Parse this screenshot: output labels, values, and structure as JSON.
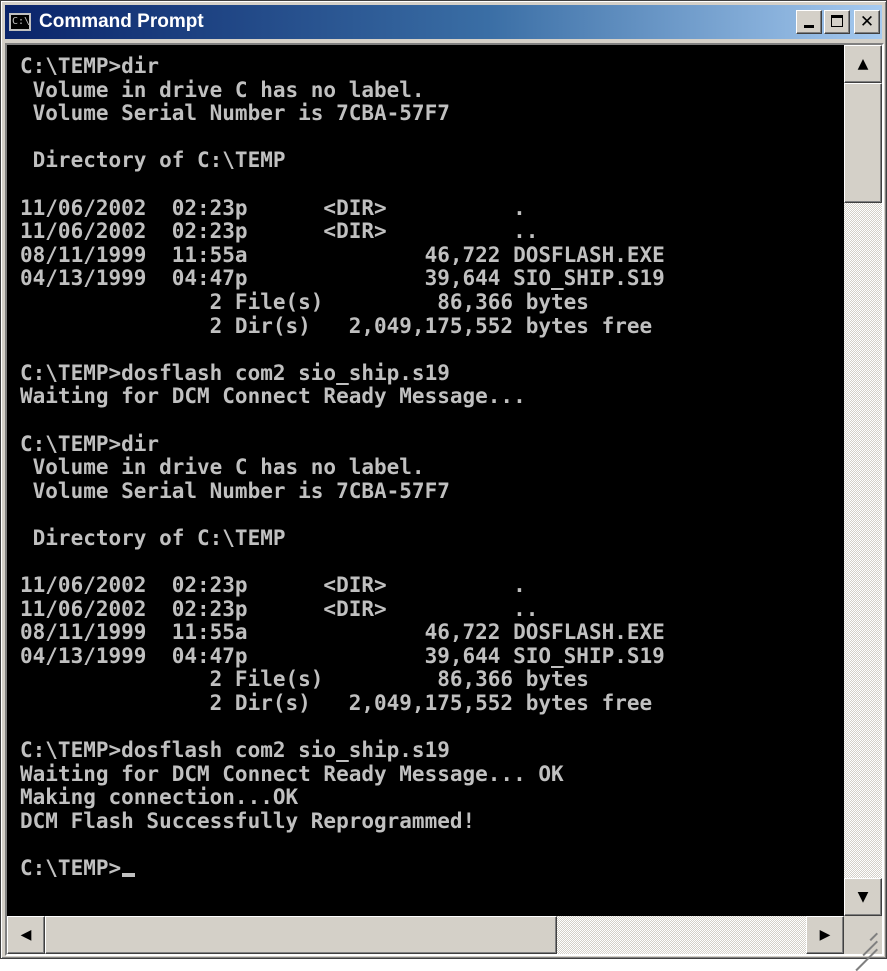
{
  "window": {
    "title": "Command Prompt",
    "icon": "command-prompt-icon",
    "icon_glyph": "C:\\",
    "buttons": {
      "minimize_icon": "minimize-icon",
      "maximize_icon": "maximize-icon",
      "close_icon": "close-icon",
      "close_glyph": "✕"
    }
  },
  "console": {
    "lines": [
      "C:\\TEMP>dir",
      " Volume in drive C has no label.",
      " Volume Serial Number is 7CBA-57F7",
      "",
      " Directory of C:\\TEMP",
      "",
      "11/06/2002  02:23p      <DIR>          .",
      "11/06/2002  02:23p      <DIR>          ..",
      "08/11/1999  11:55a              46,722 DOSFLASH.EXE",
      "04/13/1999  04:47p              39,644 SIO_SHIP.S19",
      "               2 File(s)         86,366 bytes",
      "               2 Dir(s)   2,049,175,552 bytes free",
      "",
      "C:\\TEMP>dosflash com2 sio_ship.s19",
      "Waiting for DCM Connect Ready Message...",
      "",
      "C:\\TEMP>dir",
      " Volume in drive C has no label.",
      " Volume Serial Number is 7CBA-57F7",
      "",
      " Directory of C:\\TEMP",
      "",
      "11/06/2002  02:23p      <DIR>          .",
      "11/06/2002  02:23p      <DIR>          ..",
      "08/11/1999  11:55a              46,722 DOSFLASH.EXE",
      "04/13/1999  04:47p              39,644 SIO_SHIP.S19",
      "               2 File(s)         86,366 bytes",
      "               2 Dir(s)   2,049,175,552 bytes free",
      "",
      "C:\\TEMP>dosflash com2 sio_ship.s19",
      "Waiting for DCM Connect Ready Message... OK",
      "Making connection...OK",
      "DCM Flash Successfully Reprogrammed!",
      "",
      "C:\\TEMP>"
    ]
  },
  "scrollbars": {
    "up_arrow": "▲",
    "down_arrow": "▼",
    "left_arrow": "◀",
    "right_arrow": "▶"
  },
  "colors": {
    "console_background": "#000000",
    "console_text": "#c0c0c0",
    "title_gradient_start": "#0a246a",
    "title_gradient_end": "#a6caf0",
    "chrome": "#d4d0c8"
  }
}
